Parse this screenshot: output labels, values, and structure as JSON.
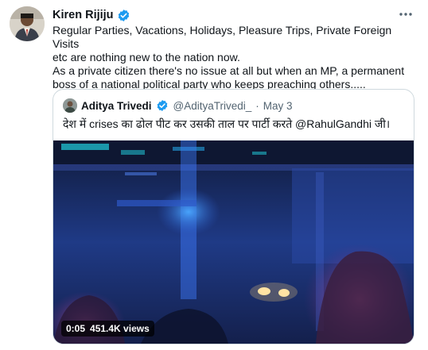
{
  "tweet": {
    "author_name": "Kiren Rijiju",
    "body_lines": [
      "Regular Parties, Vacations, Holidays, Pleasure Trips, Private Foreign Visits",
      "etc are nothing new to the nation now.",
      "As a private citizen there's no issue at all but when an MP, a permanent",
      "boss of a national political party who keeps preaching others....."
    ]
  },
  "quoted": {
    "author_name": "Aditya Trivedi",
    "handle": "@AdityaTrivedi_",
    "separator": "·",
    "date": "May 3",
    "text": "देश में crises का ढोल पीट कर उसकी ताल पर पार्टी करते @RahulGandhi जी।",
    "video": {
      "duration": "0:05",
      "views": "451.4K views"
    }
  },
  "icons": {
    "verified": "verified-badge-icon",
    "more": "more-options-icon"
  },
  "colors": {
    "verified_blue": "#1d9bf0",
    "secondary_text": "#536471",
    "border": "#cfd9de"
  }
}
